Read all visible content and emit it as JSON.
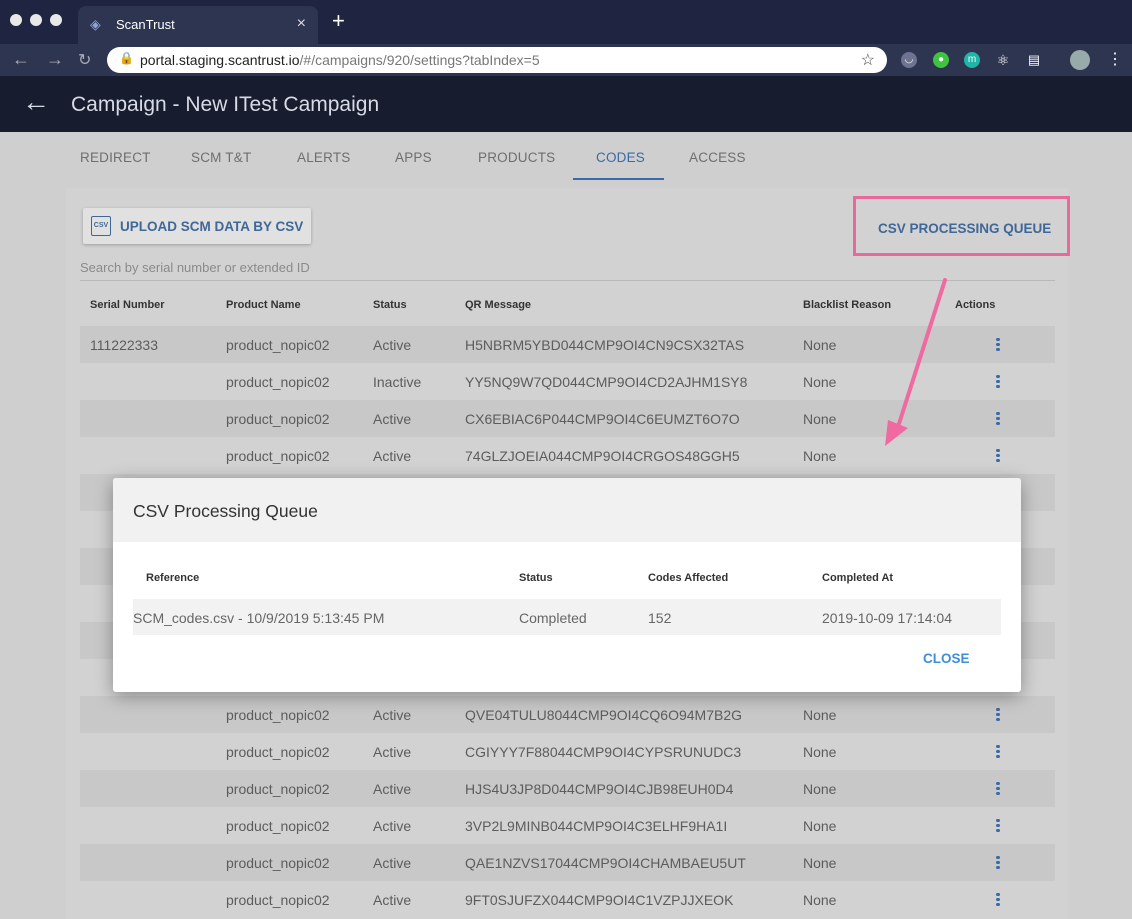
{
  "browser": {
    "tab_title": "ScanTrust",
    "url_host": "portal.staging.scantrust.io",
    "url_path": "/#/campaigns/920/settings?tabIndex=5"
  },
  "header": {
    "title": "Campaign - New ITest Campaign"
  },
  "tabs": [
    {
      "label": "REDIRECT"
    },
    {
      "label": "SCM T&T"
    },
    {
      "label": "ALERTS"
    },
    {
      "label": "APPS"
    },
    {
      "label": "PRODUCTS"
    },
    {
      "label": "CODES"
    },
    {
      "label": "ACCESS"
    }
  ],
  "toolbar": {
    "upload_label": "UPLOAD SCM DATA BY CSV",
    "upload_icon_text": "CSV",
    "queue_label": "CSV PROCESSING QUEUE"
  },
  "search": {
    "placeholder": "Search by serial number or extended ID"
  },
  "table": {
    "headers": [
      "Serial Number",
      "Product Name",
      "Status",
      "QR Message",
      "Blacklist Reason",
      "Actions"
    ],
    "rows": [
      {
        "serial": "111222333",
        "product": "product_nopic02",
        "status": "Active",
        "qr": "H5NBRM5YBD044CMP9OI4CN9CSX32TAS",
        "reason": "None"
      },
      {
        "serial": "",
        "product": "product_nopic02",
        "status": "Inactive",
        "qr": "YY5NQ9W7QD044CMP9OI4CD2AJHM1SY8",
        "reason": "None"
      },
      {
        "serial": "",
        "product": "product_nopic02",
        "status": "Active",
        "qr": "CX6EBIAC6P044CMP9OI4C6EUMZT6O7O",
        "reason": "None"
      },
      {
        "serial": "",
        "product": "product_nopic02",
        "status": "Active",
        "qr": "74GLZJOEIA044CMP9OI4CRGOS48GGH5",
        "reason": "None"
      },
      {
        "serial": "",
        "product": "product_nopic02",
        "status": "Active",
        "qr": "QVE04TULU8044CMP9OI4CQ6O94M7B2G",
        "reason": "None"
      },
      {
        "serial": "",
        "product": "product_nopic02",
        "status": "Active",
        "qr": "CGIYYY7F88044CMP9OI4CYPSRUNUDC3",
        "reason": "None"
      },
      {
        "serial": "",
        "product": "product_nopic02",
        "status": "Active",
        "qr": "HJS4U3JP8D044CMP9OI4CJB98EUH0D4",
        "reason": "None"
      },
      {
        "serial": "",
        "product": "product_nopic02",
        "status": "Active",
        "qr": "3VP2L9MINB044CMP9OI4C3ELHF9HA1I",
        "reason": "None"
      },
      {
        "serial": "",
        "product": "product_nopic02",
        "status": "Active",
        "qr": "QAE1NZVS17044CMP9OI4CHAMBAEU5UT",
        "reason": "None"
      },
      {
        "serial": "",
        "product": "product_nopic02",
        "status": "Active",
        "qr": "9FT0SJUFZX044CMP9OI4C1VZPJJXEOK",
        "reason": "None"
      }
    ]
  },
  "modal": {
    "title": "CSV Processing Queue",
    "headers": [
      "Reference",
      "Status",
      "Codes Affected",
      "Completed At"
    ],
    "row": {
      "reference": "SCM_codes.csv - 10/9/2019 5:13:45 PM",
      "status": "Completed",
      "codes": "152",
      "completed": "2019-10-09 17:14:04"
    },
    "close_label": "CLOSE"
  },
  "colors": {
    "accent": "#3b6aa8",
    "highlight": "#e86a9b",
    "appbar": "#171c2e"
  }
}
